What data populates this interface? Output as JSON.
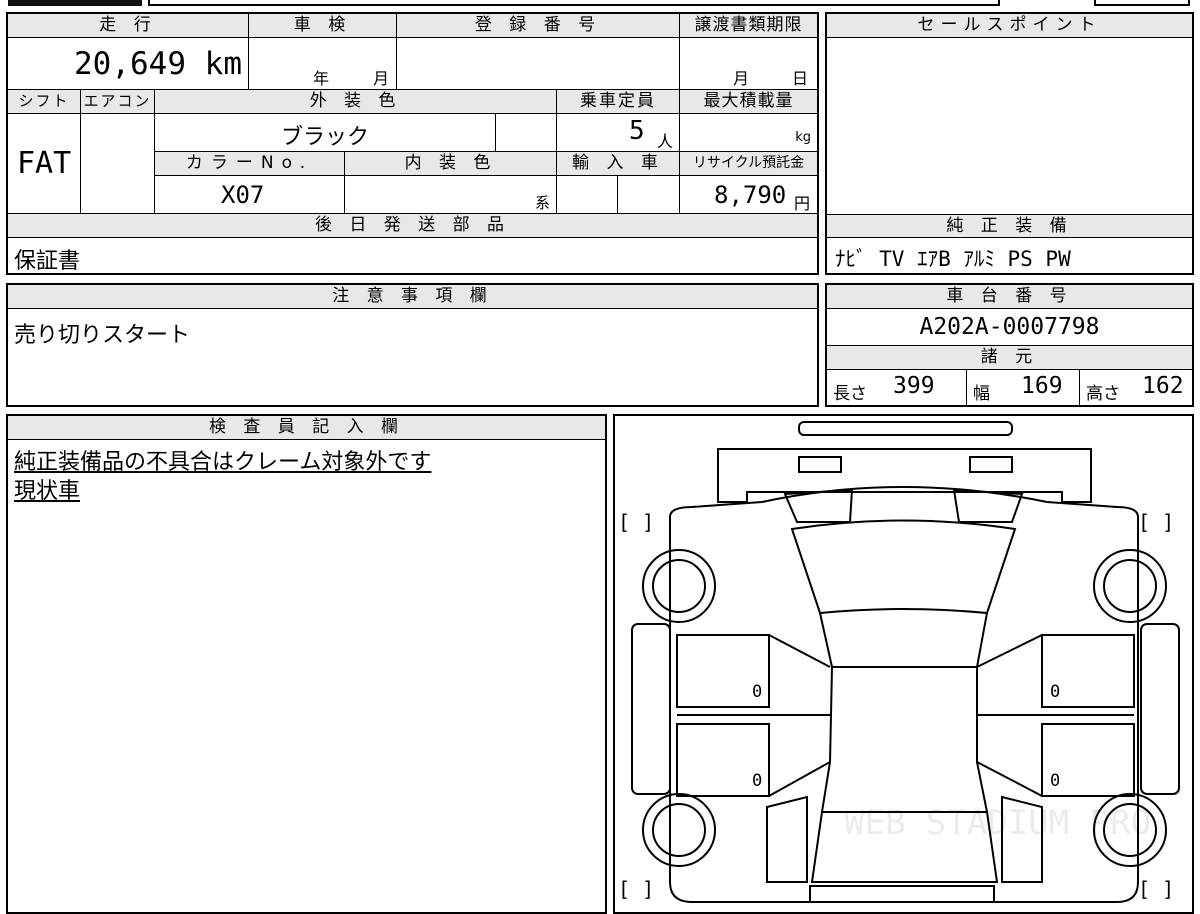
{
  "top": {
    "mileage_header": "走 行",
    "mileage_value": "20,649 km",
    "shaken_header": "車 検",
    "shaken_year": "年",
    "shaken_month": "月",
    "registration_header": "登 録 番 号",
    "registration_value": "",
    "transfer_header": "譲渡書類期限",
    "transfer_month": "月",
    "transfer_day": "日"
  },
  "vehicle": {
    "shift_header": "シフト",
    "shift_value": "FAT",
    "aircon_header": "エアコン",
    "aircon_value": "",
    "ext_color_header": "外 装 色",
    "ext_color_value": "ブラック",
    "capacity_header": "乗車定員",
    "capacity_value": "5",
    "capacity_unit": "人",
    "max_load_header": "最大積載量",
    "max_load_unit": "kg",
    "color_no_header": "カラーNo.",
    "color_no_value": "X07",
    "int_color_header": "内 装 色",
    "int_color_suffix": "系",
    "import_header": "輸 入 車",
    "recycle_header": "リサイクル預託金",
    "recycle_value": "8,790",
    "recycle_unit": "円"
  },
  "later_parts": {
    "header": "後 日 発 送 部 品",
    "value": "保証書"
  },
  "sales_point": {
    "header": "セールスポイント",
    "value": ""
  },
  "equipment": {
    "header": "純 正 装 備",
    "value": "ﾅﾋﾞ TV ｴｱB ｱﾙﾐ PS PW"
  },
  "notes": {
    "header": "注 意 事 項 欄",
    "value": "売り切りスタート"
  },
  "chassis": {
    "header": "車 台 番 号",
    "value": "A202A-0007798"
  },
  "specs": {
    "header": "諸 元",
    "length_label": "長さ",
    "length_value": "399",
    "width_label": "幅",
    "width_value": "169",
    "height_label": "高さ",
    "height_value": "162"
  },
  "inspector": {
    "header": "検 査 員 記 入 欄",
    "line1": "純正装備品の不具合はクレーム対象外です",
    "line2": "現状車"
  },
  "diagram": {
    "tire_marks": [
      "0",
      "0",
      "0",
      "0"
    ],
    "watermark": "WEB STADIUM PRO"
  }
}
